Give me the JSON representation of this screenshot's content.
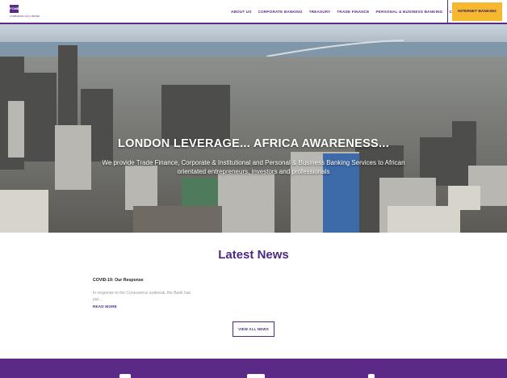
{
  "brand": {
    "logo_mark": "FCMB",
    "logo_text": "FCMB BANK (UK) LIMITED",
    "primary_color": "#5b2a86",
    "accent_color": "#f5b82e"
  },
  "nav": {
    "items": [
      {
        "label": "ABOUT US"
      },
      {
        "label": "CORPORATE BANKING"
      },
      {
        "label": "TREASURY"
      },
      {
        "label": "TRADE FINANCE"
      },
      {
        "label": "PERSONAL & BUSINESS BANKING"
      },
      {
        "label": "CONTACT"
      }
    ],
    "internet_banking_label": "INTERNET BANKING"
  },
  "hero": {
    "title": "LONDON LEVERAGE... AFRICA AWARENESS...",
    "subtitle": "We provide Trade Finance, Corporate & Institutional and Personal & Business Banking Services to African orientated entrepreneurs, investors and professionals"
  },
  "news": {
    "heading": "Latest News",
    "items": [
      {
        "title": "COVID-19: Our Response",
        "excerpt": "In response to the Coronavirus outbreak, the Bank has put...",
        "more_label": "READ MORE"
      }
    ],
    "view_all_label": "VIEW ALL NEWS"
  }
}
